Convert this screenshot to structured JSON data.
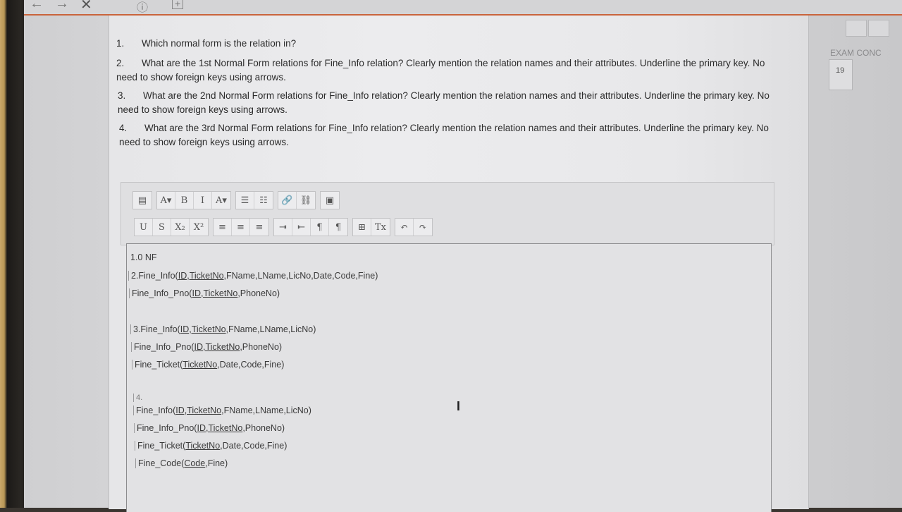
{
  "browser": {
    "nav": {
      "back": "←",
      "forward": "→",
      "close": "✕",
      "info": "ⓘ",
      "new_tab": "+"
    }
  },
  "questions": [
    {
      "num": "1.",
      "text": "Which normal form is the relation in?"
    },
    {
      "num": "2.",
      "text": "What are the 1st Normal Form relations for Fine_Info relation? Clearly mention the relation names and their attributes. Underline the primary key. No need to show foreign keys using arrows."
    },
    {
      "num": "3.",
      "text": "What are the 2nd Normal Form relations for Fine_Info relation? Clearly mention the relation names and their attributes. Underline the primary key. No need to show foreign keys using arrows."
    },
    {
      "num": "4.",
      "text": "What are the 3rd Normal Form relations for Fine_Info relation? Clearly mention the relation names and their attributes. Underline the primary key. No need to show foreign keys using arrows."
    }
  ],
  "toolbar": {
    "row1": [
      [
        "▤"
      ],
      [
        "A▾",
        "B",
        "I",
        "A▾"
      ],
      [
        "☰",
        "☷"
      ],
      [
        "🔗",
        "⛓"
      ],
      [
        "▣"
      ]
    ],
    "row2": [
      [
        "U",
        "S",
        "X₂",
        "X²"
      ],
      [
        "≡",
        "≡",
        "≡"
      ],
      [
        "⇥",
        "⇤",
        "¶",
        "¶"
      ],
      [
        "⊞",
        "Tx"
      ],
      [
        "↶",
        "↷"
      ]
    ]
  },
  "answer": {
    "l1": "1.0 NF",
    "a2_prefix": "2.Fine_Info(",
    "a2_key": "ID,TicketNo",
    "a2_rest": ",FName,LName,LicNo,Date,Code,Fine)",
    "a2b_prefix": "Fine_Info_Pno(",
    "a2b_key": "ID,TicketNo",
    "a2b_rest": ",PhoneNo)",
    "a3_prefix": "3.Fine_Info(",
    "a3_key": "ID,TicketNo",
    "a3_rest": ",FName,LName,LicNo)",
    "a3b_prefix": "Fine_Info_Pno(",
    "a3b_key": "ID,TicketNo",
    "a3b_rest": ",PhoneNo)",
    "a3c_prefix": "Fine_Ticket(",
    "a3c_key": "TicketNo",
    "a3c_rest": ",Date,Code,Fine)",
    "a4_num": "4.",
    "a4_prefix": "Fine_Info(",
    "a4_key": "ID,TicketNo",
    "a4_rest": ",FName,LName,LicNo)",
    "a4b_prefix": "Fine_Info_Pno(",
    "a4b_key": "ID,TicketNo",
    "a4b_rest": ",PhoneNo)",
    "a4c_prefix": "Fine_Ticket(",
    "a4c_key": "TicketNo",
    "a4c_rest": ",Date,Code,Fine)",
    "a4d_prefix": "Fine_Code(",
    "a4d_key": "Code",
    "a4d_rest": ",Fine)"
  },
  "sidebar": {
    "exam_label": "EXAM CONC",
    "exam_value": "19"
  }
}
